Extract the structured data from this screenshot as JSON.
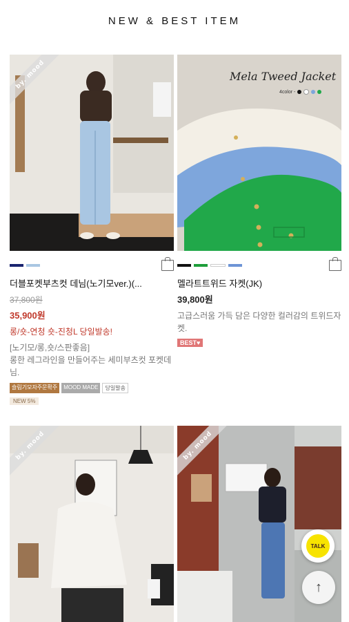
{
  "header": {
    "title": "NEW & BEST ITEM"
  },
  "ribbon_label": "by. mood",
  "products": [
    {
      "swatches": [
        "#1a2470",
        "#a9c6e2"
      ],
      "name": "더블포켓부츠컷 데님(노기모ver.)(...",
      "old_price": "37,800원",
      "price": "35,900원",
      "promo": "롱/숏-연청 숏-진청L 당일발송!",
      "desc": "[노기모/롱,숏/스판좋음]\n롱한 레그라인을 만들어주는 세미부츠컷 포켓데님.",
      "badges": [
        "슬림기모자주문확주",
        "MOOD MADE",
        "당일발송"
      ],
      "new_badge": "NEW 5%"
    },
    {
      "swatches": [
        "#111111",
        "#1e9e3a",
        "#ffffff",
        "#6d94d6"
      ],
      "name": "멜라트트위드 자켓(JK)",
      "price": "39,800원",
      "desc": "고급스러움 가득 담은 다양한 컬러감의 트위드자켓.",
      "best_badge": "BEST♥",
      "image_title": "Mela Tweed Jacket",
      "image_subtitle": "4color -"
    }
  ],
  "talk_label": "TALK",
  "top_label": "↑",
  "colors": {
    "sale": "#c0392b",
    "best": "#e07676",
    "kakao": "#f7e300"
  }
}
